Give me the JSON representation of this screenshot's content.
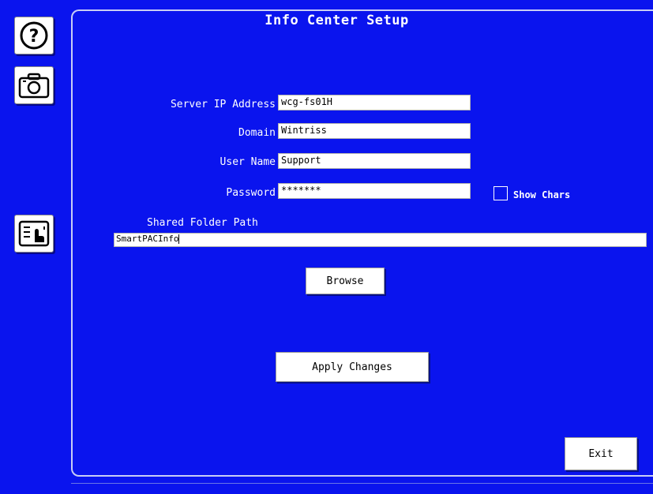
{
  "window": {
    "title": "Info Center Setup"
  },
  "sidebar": {
    "help_icon": "help-icon",
    "camera_icon": "camera-icon",
    "touch_list_icon": "touch-list-icon"
  },
  "form": {
    "server_ip": {
      "label": "Server IP Address",
      "value": "wcg-fs01H"
    },
    "domain": {
      "label": "Domain",
      "value": "Wintriss"
    },
    "user_name": {
      "label": "User Name",
      "value": "Support"
    },
    "password": {
      "label": "Password",
      "value": "*******"
    },
    "show_chars": {
      "label": "Show Chars",
      "checked": false
    },
    "shared_folder": {
      "label": "Shared Folder Path",
      "value": "SmartPACInfo"
    }
  },
  "buttons": {
    "browse": "Browse",
    "apply": "Apply Changes",
    "exit": "Exit"
  },
  "colors": {
    "background": "#0a14ee",
    "field": "#ffffff",
    "text": "#ffffff"
  }
}
